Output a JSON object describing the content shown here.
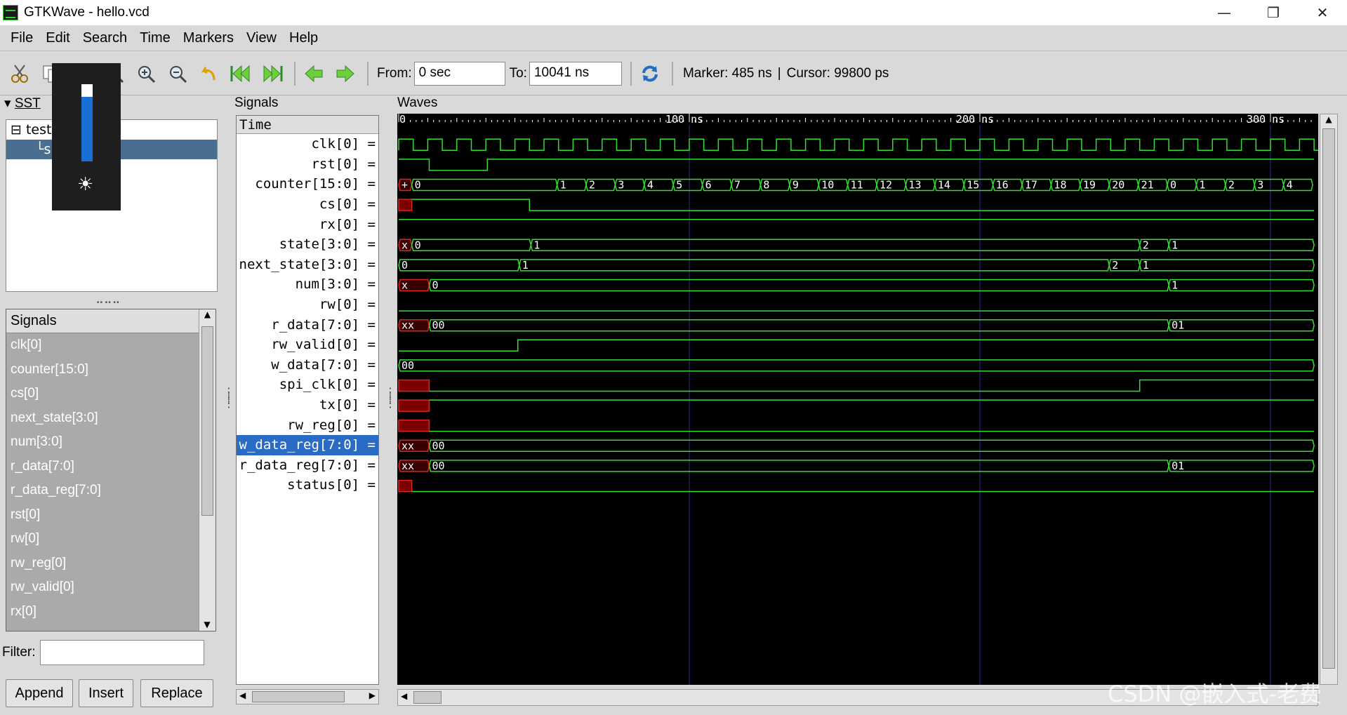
{
  "window": {
    "title": "GTKWave - hello.vcd",
    "minimize": "—",
    "restore": "❐",
    "close": "✕"
  },
  "menu": [
    "File",
    "Edit",
    "Search",
    "Time",
    "Markers",
    "View",
    "Help"
  ],
  "toolbar": {
    "from_label": "From:",
    "from_value": "0 sec",
    "to_label": "To:",
    "to_value": "10041 ns",
    "marker": "Marker: 485 ns",
    "separator": "|",
    "cursor": "Cursor: 99800 ps"
  },
  "sst": {
    "label": "SST",
    "tree": [
      {
        "label": "test",
        "expander": "⊟"
      },
      {
        "label": "s",
        "connector": "└"
      }
    ]
  },
  "signals_list": {
    "header": "Signals",
    "items": [
      "clk[0]",
      "counter[15:0]",
      "cs[0]",
      "next_state[3:0]",
      "num[3:0]",
      "r_data[7:0]",
      "r_data_reg[7:0]",
      "rst[0]",
      "rw[0]",
      "rw_reg[0]",
      "rw_valid[0]",
      "rx[0]",
      "s..."
    ]
  },
  "filter": {
    "label": "Filter:",
    "value": ""
  },
  "buttons": {
    "append": "Append",
    "insert": "Insert",
    "replace": "Replace"
  },
  "signals_panel": {
    "label": "Signals",
    "time_header": "Time",
    "rows": [
      "clk[0] =",
      "rst[0] =",
      "counter[15:0] =",
      "cs[0] =",
      "rx[0] =",
      "state[3:0] =",
      "next_state[3:0] =",
      "num[3:0] =",
      "rw[0] =",
      "r_data[7:0] =",
      "rw_valid[0] =",
      "w_data[7:0] =",
      "spi_clk[0] =",
      "tx[0] =",
      "rw_reg[0] =",
      "w_data_reg[7:0] =",
      "r_data_reg[7:0] =",
      "status[0] ="
    ],
    "selected_index": 15
  },
  "waves": {
    "label": "Waves",
    "time_axis": {
      "ticks": [
        {
          "t": 0,
          "label": "0"
        },
        {
          "t": 100,
          "label": "100 ns"
        },
        {
          "t": 200,
          "label": "200 ns"
        },
        {
          "t": 300,
          "label": "300 ns"
        }
      ],
      "visible_range_ns": [
        0,
        315
      ]
    },
    "clock_period_ns": 10,
    "colors": {
      "wave": "#33dd33",
      "undefined": "#dd2222",
      "grid": "#2a2a9a",
      "axis_text": "#ffffff"
    },
    "counter_values": [
      "0",
      "1",
      "2",
      "3",
      "4",
      "5",
      "6",
      "7",
      "8",
      "9",
      "10",
      "11",
      "12",
      "13",
      "14",
      "15",
      "16",
      "17",
      "18",
      "19",
      "20",
      "21",
      "0",
      "1",
      "2",
      "3",
      "4"
    ],
    "bus_labels": {
      "counter_first": "+",
      "state": [
        "x",
        "0",
        "1",
        "2",
        "1"
      ],
      "next_state": [
        "0",
        "1",
        "2",
        "1"
      ],
      "num": [
        "x",
        "0",
        "1"
      ],
      "r_data": [
        "xx",
        "00",
        "01"
      ],
      "w_data": [
        "00"
      ],
      "w_data_reg": [
        "xx",
        "00"
      ],
      "r_data_reg": [
        "xx",
        "00",
        "01"
      ]
    }
  },
  "watermark": "CSDN @嵌入式-老费"
}
